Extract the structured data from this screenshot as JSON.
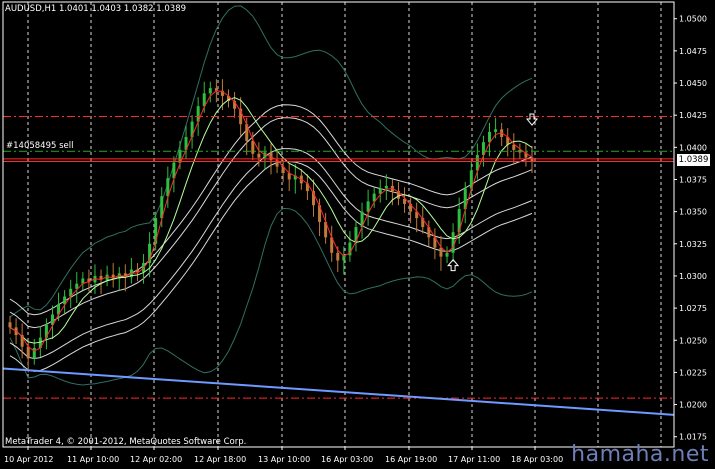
{
  "header": {
    "symbol_info": "AUDUSD,H1  1.0401 1.0403 1.0382 1.0389"
  },
  "order_label": "#14058495 sell",
  "current_price_label": "1.0389",
  "footer": {
    "copyright": "MetaTrader 4, © 2001-2012, MetaQuotes Software Corp.",
    "watermark": "hamaha.net"
  },
  "colors": {
    "background": "#000000",
    "bull_candle": "#2fbf3f",
    "bear_candle": "#c07a3a",
    "fast_ma": "#ff2a2a",
    "slow_ma": "#b6ff9a",
    "envelope": "#ffffff",
    "bollinger": "#2f6f5f",
    "trendline": "#6f9aff",
    "level_line": "#ff2a2a",
    "green_level": "#22aa22"
  },
  "chart_data": {
    "type": "candlestick",
    "title": "AUDUSD,H1",
    "y_tick_labels": [
      "1.0500",
      "1.0475",
      "1.0450",
      "1.0425",
      "1.0400",
      "1.0375",
      "1.0350",
      "1.0325",
      "1.0300",
      "1.0275",
      "1.0250",
      "1.0225",
      "1.0200",
      "1.0175"
    ],
    "ylim": [
      1.0167,
      1.0513
    ],
    "x_tick_labels": [
      "10 Apr 2012",
      "11 Apr 10:00",
      "12 Apr 02:00",
      "12 Apr 18:00",
      "13 Apr 10:00",
      "16 Apr 03:00",
      "16 Apr 19:00",
      "17 Apr 11:00",
      "18 Apr 03:00"
    ],
    "horizontal_levels": [
      {
        "name": "upper-level",
        "price": 1.0424,
        "style": "dash-dot",
        "color": "#ff2a2a"
      },
      {
        "name": "green-level",
        "price": 1.0397,
        "style": "dash-dot",
        "color": "#22aa22"
      },
      {
        "name": "order-level",
        "price": 1.0391,
        "style": "solid",
        "color": "#ff2a2a"
      },
      {
        "name": "price-level",
        "price": 1.0389,
        "style": "solid",
        "color": "#ff2a2a"
      },
      {
        "name": "lower-level",
        "price": 1.0205,
        "style": "dash-dot",
        "color": "#ff2a2a"
      }
    ],
    "trendline": {
      "start": [
        0,
        1.0228
      ],
      "end": [
        1,
        1.0192
      ]
    },
    "close_series": [
      1.026,
      1.0254,
      1.0245,
      1.0236,
      1.0244,
      1.0252,
      1.0262,
      1.027,
      1.0278,
      1.0284,
      1.029,
      1.0294,
      1.0298,
      1.0295,
      1.03,
      1.0297,
      1.0301,
      1.0298,
      1.0302,
      1.0299,
      1.0305,
      1.0303,
      1.031,
      1.0325,
      1.0345,
      1.0362,
      1.0376,
      1.0388,
      1.0398,
      1.0408,
      1.042,
      1.0432,
      1.0442,
      1.0446,
      1.0444,
      1.044,
      1.0436,
      1.043,
      1.0418,
      1.0405,
      1.0395,
      1.0392,
      1.0396,
      1.039,
      1.0385,
      1.038,
      1.0375,
      1.0378,
      1.0372,
      1.0366,
      1.0355,
      1.0342,
      1.033,
      1.0318,
      1.0312,
      1.0316,
      1.0326,
      1.0338,
      1.035,
      1.0358,
      1.0364,
      1.0368,
      1.037,
      1.0366,
      1.036,
      1.0356,
      1.035,
      1.0345,
      1.0338,
      1.033,
      1.0322,
      1.0315,
      1.0318,
      1.0334,
      1.0352,
      1.0368,
      1.0382,
      1.0394,
      1.0404,
      1.0412,
      1.0414,
      1.0408,
      1.0402,
      1.0398,
      1.0396,
      1.0392,
      1.0389
    ],
    "arrows": [
      {
        "type": "buy-arrow",
        "index": 73,
        "price": 1.0308
      },
      {
        "type": "sell-arrow",
        "index": 86,
        "price": 1.0422
      }
    ]
  }
}
